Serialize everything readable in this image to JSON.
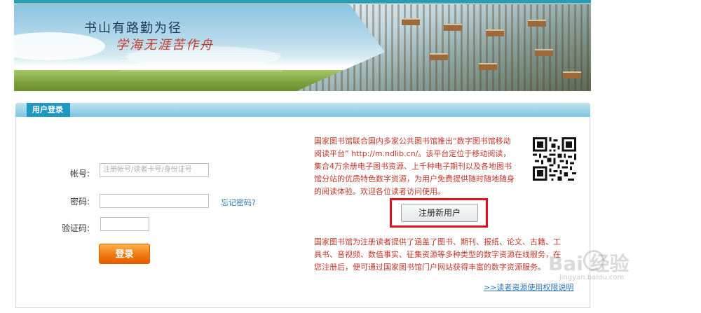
{
  "banner": {
    "slogan_line1": "书山有路勤为径",
    "slogan_line2": "学海无涯苦作舟"
  },
  "panel": {
    "title": "用户登录"
  },
  "login": {
    "account_label": "帐号:",
    "account_placeholder": "注册帐号/读者卡号/身份证号",
    "password_label": "密码:",
    "password_value": "",
    "forgot_password": "忘记密码?",
    "captcha_label": "验证码:",
    "captcha_value": "",
    "login_button": "登录"
  },
  "mobile_promo": {
    "line1": "国家图书馆联合国内多家公共图书馆推出“数字图书馆移动",
    "line2": "阅读平台” http://m.ndlib.cn/。该平台定位于移动阅读，",
    "line3": "集合4万余册电子图书资源、上千种电子期刊以及各地图书",
    "line4": "馆分站的优质特色数字资源，为用户免费提供随时随地随身",
    "line5": "的阅读体验。欢迎各位读者访问使用。"
  },
  "register_button": "注册新用户",
  "register_info": {
    "line1": "国家图书馆为注册读者提供了涵盖了图书、期刊、报纸、论文、古籍、工",
    "line2": "具书、音视频、数值事实、征集资源等多种类型的数字资源在线服务，在",
    "line3": "您注册后，便可通过国家图书馆门户网站获得丰富的数字资源服务。"
  },
  "rights_link": ">>读者资源使用权限说明",
  "watermark": {
    "brand": "Bai  经验",
    "url": "jingyan.baidu.com"
  },
  "colors": {
    "accent": "#1f98c2",
    "login_button": "#f07a10",
    "promo_text": "#c0392b",
    "link": "#2e75b6",
    "highlight_box": "#e0101e"
  }
}
